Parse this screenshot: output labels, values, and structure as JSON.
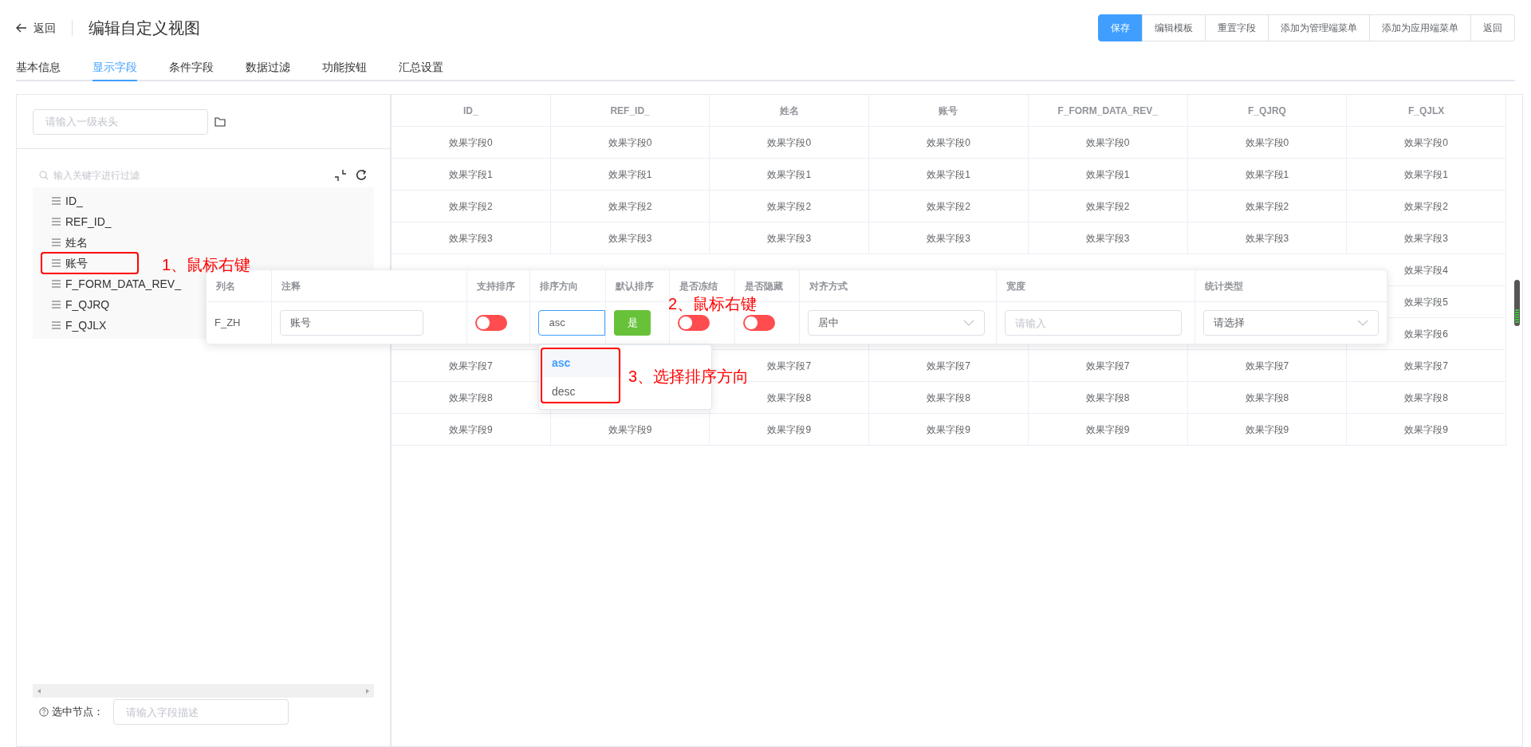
{
  "header": {
    "back": "返回",
    "title": "编辑自定义视图",
    "buttons": [
      {
        "label": "保存",
        "primary": true
      },
      {
        "label": "编辑模板",
        "primary": false
      },
      {
        "label": "重置字段",
        "primary": false
      },
      {
        "label": "添加为管理端菜单",
        "primary": false
      },
      {
        "label": "添加为应用端菜单",
        "primary": false
      },
      {
        "label": "返回",
        "primary": false
      }
    ]
  },
  "tabs": [
    {
      "label": "基本信息",
      "selected": false
    },
    {
      "label": "显示字段",
      "selected": true
    },
    {
      "label": "条件字段",
      "selected": false
    },
    {
      "label": "数据过滤",
      "selected": false
    },
    {
      "label": "功能按钮",
      "selected": false
    },
    {
      "label": "汇总设置",
      "selected": false
    }
  ],
  "left_panel": {
    "header_input": {
      "placeholder": "请输入一级表头"
    },
    "filter": {
      "placeholder": "输入关键字进行过滤"
    },
    "tree": [
      {
        "label": "ID_"
      },
      {
        "label": "REF_ID_"
      },
      {
        "label": "姓名"
      },
      {
        "label": "账号"
      },
      {
        "label": "F_FORM_DATA_REV_"
      },
      {
        "label": "F_QJRQ"
      },
      {
        "label": "F_QJLX"
      }
    ],
    "selected_node": {
      "label": "选中节点：",
      "placeholder": "请输入字段描述"
    }
  },
  "table": {
    "columns": [
      "ID_",
      "REF_ID_",
      "姓名",
      "账号",
      "F_FORM_DATA_REV_",
      "F_QJRQ",
      "F_QJLX"
    ],
    "rows": [
      {
        "cells": [
          "效果字段0",
          "效果字段0",
          "效果字段0",
          "效果字段0",
          "效果字段0",
          "效果字段0",
          "效果字段0"
        ]
      },
      {
        "cells": [
          "效果字段1",
          "效果字段1",
          "效果字段1",
          "效果字段1",
          "效果字段1",
          "效果字段1",
          "效果字段1"
        ]
      },
      {
        "cells": [
          "效果字段2",
          "效果字段2",
          "效果字段2",
          "效果字段2",
          "效果字段2",
          "效果字段2",
          "效果字段2"
        ]
      },
      {
        "cells": [
          "效果字段3",
          "效果字段3",
          "效果字段3",
          "效果字段3",
          "效果字段3",
          "效果字段3",
          "效果字段3"
        ]
      },
      {
        "cells": [
          null,
          null,
          null,
          null,
          null,
          null,
          "效果字段4"
        ]
      },
      {
        "cells": [
          null,
          null,
          null,
          null,
          null,
          null,
          "效果字段5"
        ]
      },
      {
        "cells": [
          null,
          null,
          null,
          null,
          null,
          null,
          "效果字段6"
        ]
      },
      {
        "cells": [
          "效果字段7",
          null,
          "效果字段7",
          "效果字段7",
          "效果字段7",
          "效果字段7",
          "效果字段7"
        ]
      },
      {
        "cells": [
          "效果字段8",
          null,
          "效果字段8",
          "效果字段8",
          "效果字段8",
          "效果字段8",
          "效果字段8"
        ]
      },
      {
        "cells": [
          "效果字段9",
          "效果字段9",
          "效果字段9",
          "效果字段9",
          "效果字段9",
          "效果字段9",
          "效果字段9"
        ]
      }
    ]
  },
  "popup": {
    "columns": [
      "列名",
      "注释",
      "支持排序",
      "排序方向",
      "默认排序",
      "是否冻结",
      "是否隐藏",
      "对齐方式",
      "宽度",
      "统计类型"
    ],
    "row": {
      "column_name": "F_ZH",
      "comment": "账号",
      "sortable": {
        "on": false
      },
      "sort_direction": "asc",
      "default_sort": "是",
      "frozen": {
        "on": false
      },
      "hidden": {
        "on": false
      },
      "align": "居中",
      "width": {
        "placeholder": "请输入"
      },
      "stat_type": "请选择"
    }
  },
  "dropdown": {
    "options": [
      {
        "label": "asc",
        "selected": true
      },
      {
        "label": "desc",
        "selected": false
      }
    ]
  },
  "annotations": [
    {
      "text": "1、鼠标右键"
    },
    {
      "text": "2、鼠标右键"
    },
    {
      "text": "3、选择排序方向"
    }
  ]
}
